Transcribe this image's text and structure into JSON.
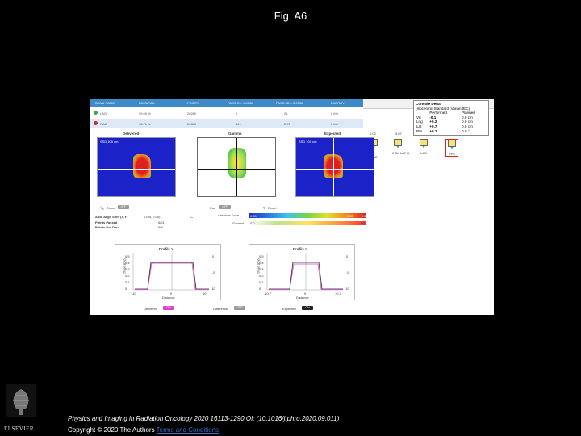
{
  "figure_title": "Fig. A6",
  "table": {
    "headers": [
      "BEAM NAME",
      "PASS/FAIL",
      "POINTS",
      "PASS G < 1.0MM",
      "PASS 3D < 3.0MM",
      "ENERGY"
    ],
    "rows": [
      {
        "name": "LAO",
        "pass": "99.69 %",
        "points": "20280",
        "g": "0",
        "d": "21",
        "energy": "6 MV",
        "status_color": "#3aa64a"
      },
      {
        "name": "RAO",
        "pass": "98.71 %",
        "points": "20380",
        "g": "321",
        "d": "2.97",
        "energy": "6 MV",
        "status_color": "#d02828"
      }
    ]
  },
  "comparison": {
    "title": "Console Delta",
    "subtitle": "(Isocentric Standard, Varian IEC)",
    "col_performed": "Performed",
    "col_planned": "Planned",
    "rows": [
      {
        "label": "Vrt",
        "performed": "-0.1",
        "planned": "0.0 cm"
      },
      {
        "label": "Lng",
        "performed": "+0.2",
        "planned": "0.0 cm"
      },
      {
        "label": "Lat",
        "performed": "+0.7",
        "planned": "0.0 cm"
      },
      {
        "label": "Rtn",
        "performed": "+0.1",
        "planned": "0.0 °"
      }
    ]
  },
  "field_values": [
    "0.00",
    "3.07"
  ],
  "fields": [
    "2 BUMP",
    "0 BU LAT LI",
    "LAO",
    "RPC"
  ],
  "panels": {
    "delivered": "Delivered",
    "gamma": "Gamma",
    "expected": "Expected",
    "delivered_tag": "SSD 100 cm",
    "expected_tag": "SSD 100 cm"
  },
  "controls": {
    "zoom": "Zoom",
    "zoom_toggle": "OFF",
    "pan": "Pan",
    "pan_toggle": "OFF",
    "reset": "Reset",
    "absolute_dose": "Absolute Dose",
    "absolute_min": "0.00",
    "absolute_max": "0.20",
    "absolute_val": "0.20",
    "gamma": "Gamma",
    "gamma_min": "0.0",
    "gamma_max": "1.0"
  },
  "stats": [
    {
      "label": "Auto Align Shift (X,Y)",
      "value": "(0.00, 2.00)"
    },
    {
      "label": "Points Passed",
      "value": "6/21"
    },
    {
      "label": "Points Not Dev.",
      "value": "6/8"
    }
  ],
  "profiles": {
    "y_title": "Profile Y",
    "x_title": "Profile X",
    "xlabel": "Distance",
    "x_ticks": [
      "-10",
      "0",
      "10"
    ],
    "x_ticks_x": [
      "-10.7",
      "0",
      "10.7"
    ],
    "y_ticks": [
      "0.5",
      "0.4",
      "0.3",
      "0.2",
      "0.1",
      "0"
    ],
    "right_ticks": [
      "0",
      "-5",
      "-10"
    ],
    "ylabel": "Dose (Gy)",
    "right_label": "Gamma"
  },
  "bottom": {
    "delivered": "Delivered",
    "delivered_state": "ON",
    "difference": "Difference",
    "difference_state": "OFF",
    "expected": "Expected",
    "expected_state": "ON"
  },
  "footer": {
    "journal": "Physics and Imaging in Radiation Oncology 2020 16113-1290 OI: (10.1016/j.phro.2020.09.011)",
    "copyright": "Copyright © 2020 The Authors",
    "license": "Terms and Conditions",
    "publisher": "ELSEVIER"
  },
  "colors": {
    "header_blue": "#3d8ac8",
    "dose_panel_blue": "#1b22c8",
    "toggle_on": "#e040c8",
    "toggle_dark": "#222222"
  }
}
